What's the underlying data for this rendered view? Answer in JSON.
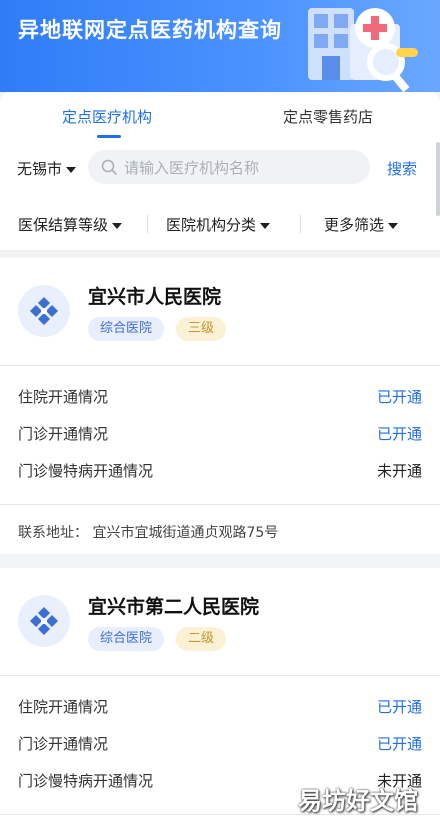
{
  "header": {
    "title": "异地联网定点医药机构查询"
  },
  "tabs": [
    {
      "label": "定点医疗机构",
      "active": true
    },
    {
      "label": "定点零售药店",
      "active": false
    }
  ],
  "search": {
    "city": "无锡市",
    "placeholder": "请输入医疗机构名称",
    "value": "",
    "button": "搜索"
  },
  "filters": [
    "医保结算等级",
    "医院机构分类",
    "更多筛选"
  ],
  "colors": {
    "primary": "#1f6fe8",
    "header_start": "#2f7cf6",
    "tag_type_bg": "#e8eefb",
    "tag_level_bg": "#fbf1d4"
  },
  "hospitals": [
    {
      "name": "宜兴市人民医院",
      "type": "综合医院",
      "level": "三级",
      "rows": [
        {
          "label": "住院开通情况",
          "status": "已开通"
        },
        {
          "label": "门诊开通情况",
          "status": "已开通"
        },
        {
          "label": "门诊慢特病开通情况",
          "status": "未开通"
        }
      ],
      "address_label": "联系地址：",
      "address": "宜兴市宜城街道通贞观路75号"
    },
    {
      "name": "宜兴市第二人民医院",
      "type": "综合医院",
      "level": "二级",
      "rows": [
        {
          "label": "住院开通情况",
          "status": "已开通"
        },
        {
          "label": "门诊开通情况",
          "status": "已开通"
        },
        {
          "label": "门诊慢特病开通情况",
          "status": "未开通"
        }
      ]
    }
  ],
  "watermark": "易坊好文馆"
}
